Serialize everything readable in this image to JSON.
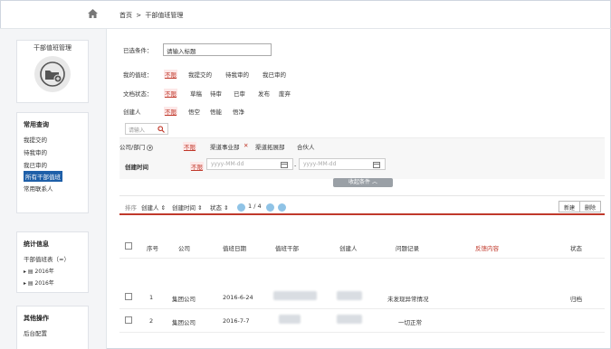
{
  "breadcrumb": {
    "home": "首页",
    "sep": ">",
    "current": "干部值班管理"
  },
  "sidebar": {
    "duty_title": "干部值班管理",
    "common_query": {
      "title": "常用查询",
      "items": [
        "我提交的",
        "待我审的",
        "我已审的",
        "所有干部值班",
        "常用联系人"
      ]
    },
    "stats": {
      "title": "统计信息",
      "item": "干部值班表（≈）",
      "sub": [
        "2016年",
        "2016年"
      ]
    },
    "other": {
      "title": "其他操作",
      "item": "后台配置"
    }
  },
  "filters": {
    "selected_label": "已选条件：",
    "selected_value": "请输入标题",
    "my_duty": {
      "label": "我的值班：",
      "options": [
        "不限",
        "我提交的",
        "待我审的",
        "我已审的"
      ]
    },
    "doc_status": {
      "label": "文档状态：",
      "options": [
        "不限",
        "草稿",
        "待审",
        "已审",
        "发布",
        "废弃"
      ]
    },
    "creator": {
      "label": "创建人",
      "options": [
        "不限",
        "悟空",
        "悟能",
        "悟净"
      ]
    },
    "search_placeholder": "请输入",
    "company": {
      "label": "公司/部门",
      "options": [
        "不限",
        "渠道事业部",
        "渠道拓展部",
        "合伙人"
      ]
    },
    "created_time": {
      "label": "创建时间",
      "option": "不限",
      "from_placeholder": "yyyy-MM-dd",
      "to_placeholder": "yyyy-MM-dd",
      "sep": "-"
    },
    "collapse": "收起条件"
  },
  "toolbar": {
    "sort_label": "排序",
    "sort_creator": "创建人",
    "sort_created": "创建时间",
    "sort_status": "状态",
    "page": "1 / 4",
    "new_button": "新建",
    "delete_button": "删除"
  },
  "table": {
    "columns": [
      "序号",
      "公司",
      "值班日期",
      "值班干部",
      "创建人",
      "问题记录",
      "反馈内容",
      "状态"
    ],
    "rows": [
      {
        "no": "1",
        "company": "集团公司",
        "date": "2016-6-24",
        "record": "未发现异常情况",
        "status": "归档"
      },
      {
        "no": "2",
        "company": "集团公司",
        "date": "2016-7-7",
        "record": "一切正常",
        "status": ""
      }
    ]
  },
  "colors": {
    "accent_red": "#c0392b",
    "active_blue": "#1e5fa8"
  }
}
